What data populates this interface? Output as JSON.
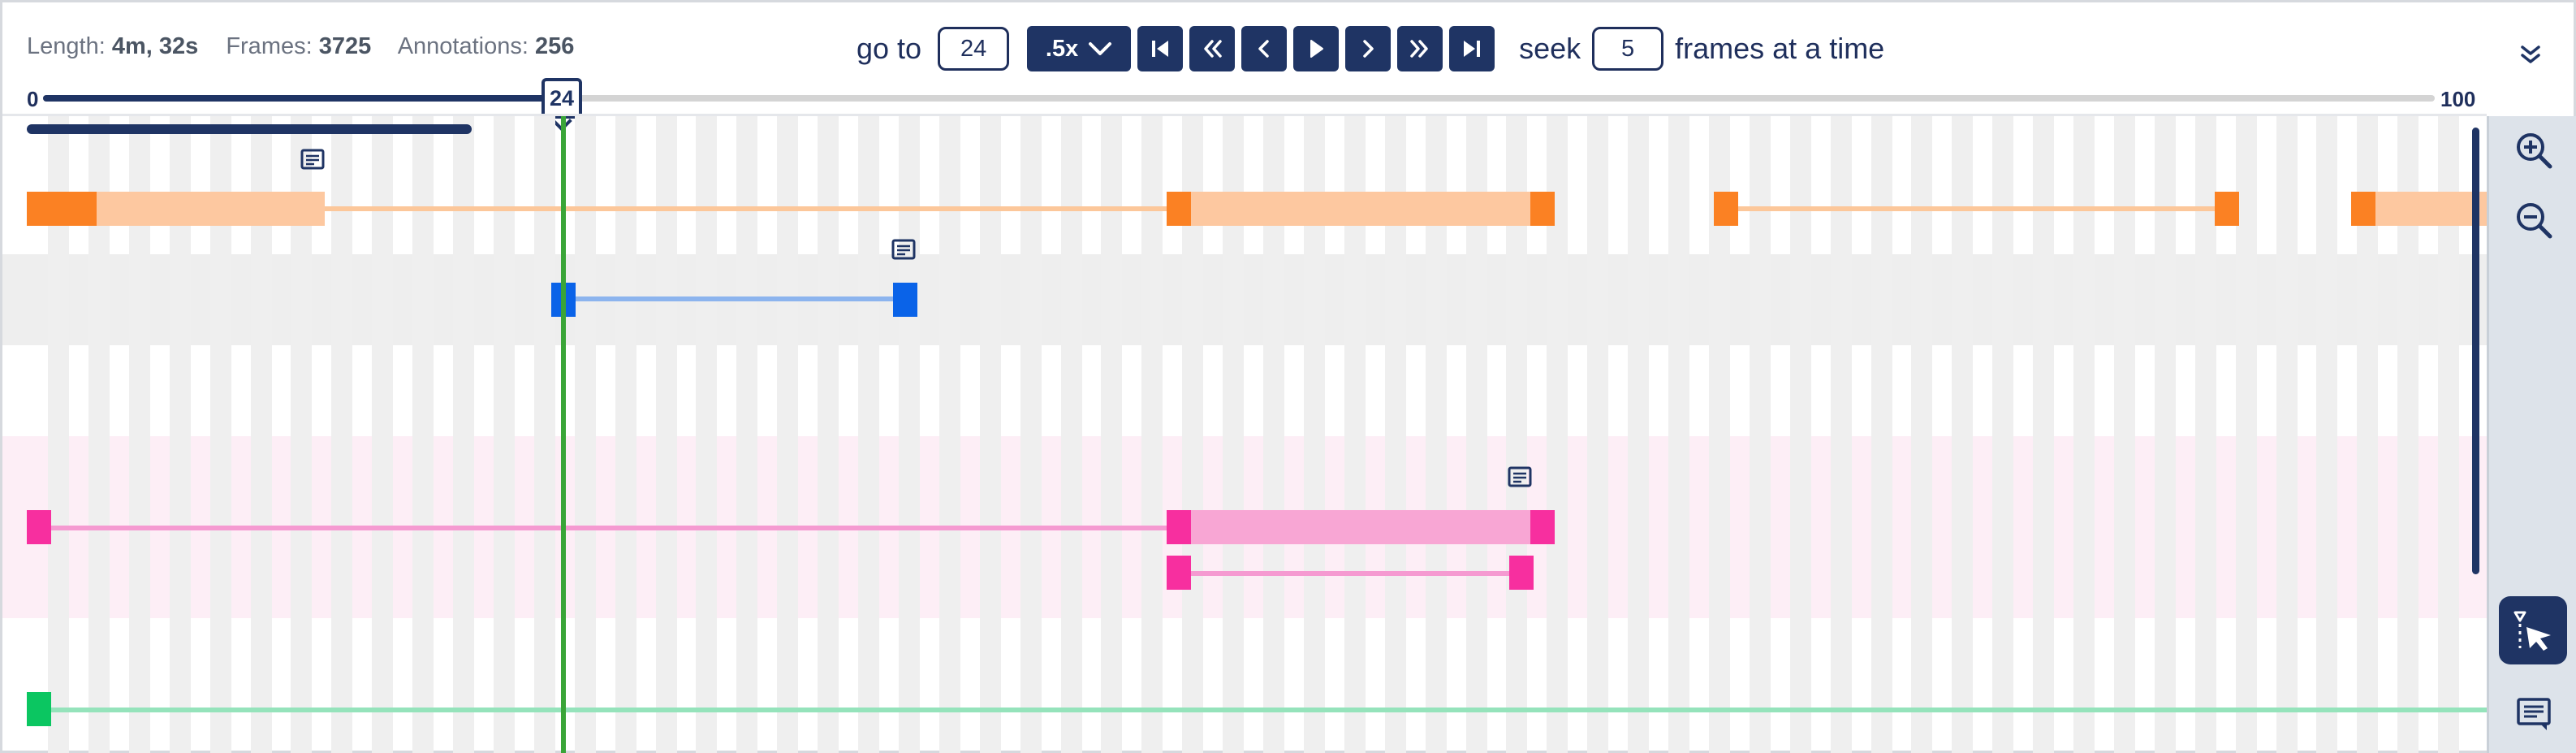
{
  "stats": {
    "length_label": "Length:",
    "length_value": "4m, 32s",
    "frames_label": "Frames:",
    "frames_value": "3725",
    "annotations_label": "Annotations:",
    "annotations_value": "256"
  },
  "controls": {
    "goto_label": "go to",
    "goto_value": "24",
    "speed_label": ".5x",
    "seek_label": "seek",
    "seek_value": "5",
    "seek_suffix": "frames at a time",
    "buttons": [
      "skip-to-start-icon",
      "rewind-fast-icon",
      "step-back-icon",
      "play-icon",
      "step-forward-icon",
      "fast-forward-icon",
      "skip-to-end-icon"
    ]
  },
  "scrubber": {
    "min_label": "0",
    "max_label": "100",
    "current_frame": "24",
    "current_fraction": 0.24
  },
  "colors": {
    "navy": "#1f3464",
    "playhead": "#3aa538",
    "orange": "#fb8123",
    "orange_light": "#fcc79a",
    "blue": "#0a63e8",
    "blue_light": "#8cb4ee",
    "pink": "#f72f9f",
    "pink_light": "#f59ad1",
    "green": "#0bc661",
    "green_light": "#95e3bb"
  },
  "toolbar": {
    "zoom_in": "zoom-in-icon",
    "zoom_out": "zoom-out-icon",
    "select_tool": "select-tool-icon",
    "comments": "comment-icon"
  }
}
